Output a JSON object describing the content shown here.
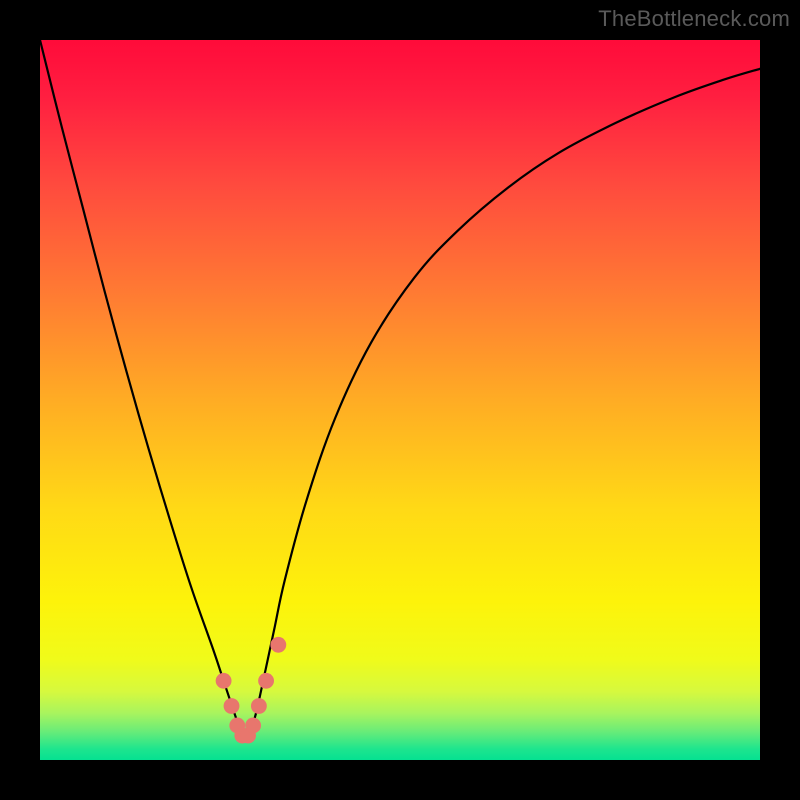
{
  "watermark": "TheBottleneck.com",
  "chart_data": {
    "type": "line",
    "title": "",
    "xlabel": "",
    "ylabel": "",
    "xlim": [
      0,
      100
    ],
    "ylim": [
      0,
      100
    ],
    "grid": false,
    "legend": "none",
    "background_gradient_stops": [
      {
        "pos": 0.0,
        "color": "#ff0b3a"
      },
      {
        "pos": 0.08,
        "color": "#ff1f40"
      },
      {
        "pos": 0.2,
        "color": "#ff4a3e"
      },
      {
        "pos": 0.35,
        "color": "#ff7a33"
      },
      {
        "pos": 0.5,
        "color": "#ffac24"
      },
      {
        "pos": 0.65,
        "color": "#ffd916"
      },
      {
        "pos": 0.78,
        "color": "#fdf30a"
      },
      {
        "pos": 0.86,
        "color": "#f0fb1a"
      },
      {
        "pos": 0.905,
        "color": "#d6f93e"
      },
      {
        "pos": 0.935,
        "color": "#a8f45e"
      },
      {
        "pos": 0.96,
        "color": "#6aec78"
      },
      {
        "pos": 0.985,
        "color": "#1de58e"
      },
      {
        "pos": 1.0,
        "color": "#05e191"
      }
    ],
    "series": [
      {
        "name": "bottleneck-curve",
        "color": "#000000",
        "x": [
          0,
          3,
          6,
          9,
          12,
          15,
          18,
          21,
          24,
          25.5,
          27,
          27.8,
          28.5,
          29.3,
          30,
          31,
          32.5,
          34,
          37,
          41,
          46,
          52,
          58,
          65,
          72,
          80,
          88,
          95,
          100
        ],
        "y": [
          100,
          88,
          76.5,
          65,
          54,
          43.5,
          33.5,
          24,
          15.5,
          11,
          6.5,
          4.3,
          3.2,
          4.3,
          6.5,
          11,
          18,
          25,
          36,
          47.5,
          58,
          67,
          73.5,
          79.5,
          84.3,
          88.5,
          92,
          94.5,
          96
        ]
      }
    ],
    "markers": {
      "name": "valley-markers",
      "color": "#e8766d",
      "radius_data_units": 1.1,
      "points": [
        {
          "x": 25.5,
          "y": 11.0
        },
        {
          "x": 26.6,
          "y": 7.5
        },
        {
          "x": 27.4,
          "y": 4.8
        },
        {
          "x": 28.1,
          "y": 3.4
        },
        {
          "x": 28.9,
          "y": 3.4
        },
        {
          "x": 29.6,
          "y": 4.8
        },
        {
          "x": 30.4,
          "y": 7.5
        },
        {
          "x": 31.4,
          "y": 11.0
        },
        {
          "x": 33.1,
          "y": 16.0
        }
      ]
    }
  }
}
